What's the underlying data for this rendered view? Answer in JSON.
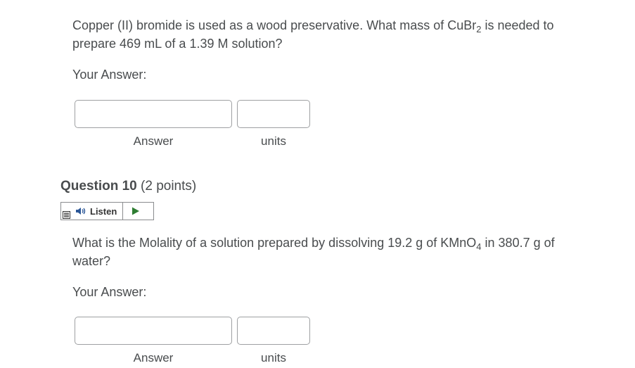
{
  "question9": {
    "text_part1": "Copper (II) bromide is used as a wood preservative. What mass of CuBr",
    "text_sub": "2",
    "text_part2": " is needed to prepare 469 mL of a 1.39 M solution?",
    "your_answer_label": "Your Answer:",
    "answer_value": "",
    "units_value": "",
    "answer_label": "Answer",
    "units_label": "units"
  },
  "question10": {
    "heading_number": "Question 10",
    "heading_points": "(2 points)",
    "listen_label": "Listen",
    "text_part1": "What is the Molality of a solution prepared by dissolving 19.2 g of KMnO",
    "text_sub": "4",
    "text_part2": "  in 380.7 g of water?",
    "your_answer_label": "Your Answer:",
    "answer_value": "",
    "units_value": "",
    "answer_label": "Answer",
    "units_label": "units"
  },
  "colors": {
    "text": "#494c4e",
    "input_border": "#9ea0a2",
    "play_green": "#2e7d32",
    "listen_border": "#8a8c8e"
  },
  "icons": {
    "menu": "hamburger-menu-icon",
    "speaker": "speaker-icon",
    "play": "play-triangle-icon"
  }
}
